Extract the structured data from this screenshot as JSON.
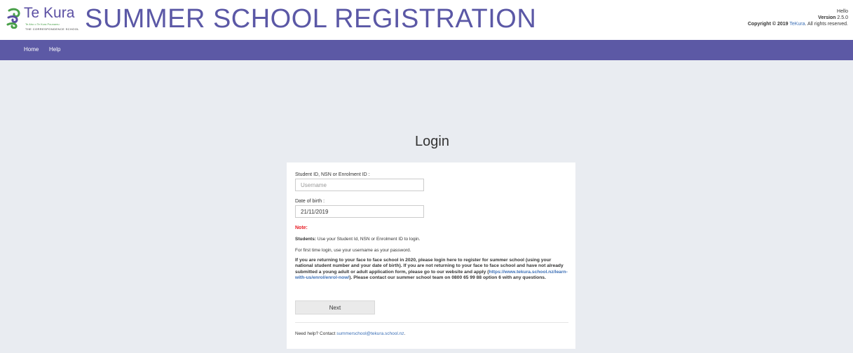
{
  "header": {
    "logo": {
      "name": "Te Kura",
      "tagline": "Te Aho o Te Kura Pounamu",
      "subtitle": "THE CORRESPONDENCE SCHOOL"
    },
    "app_title": "SUMMER SCHOOL REGISTRATION",
    "greeting": "Hello",
    "version_label": "Version",
    "version_value": "2.5.0",
    "copyright_prefix": "Copyright © 2019",
    "copyright_link": "TeKura",
    "copyright_suffix": ". All rights reserved."
  },
  "nav": {
    "items": [
      {
        "label": "Home"
      },
      {
        "label": "Help"
      }
    ]
  },
  "login": {
    "title": "Login",
    "username_label": "Student ID, NSN or Enrolment ID :",
    "username_placeholder": "Username",
    "username_value": "",
    "dob_label": "Date of birth :",
    "dob_value": "21/11/2019",
    "note_label": "Note:",
    "students_label": "Students:",
    "students_text": " Use your Student Id, NSN or Enrolment ID to login.",
    "first_login_text": "For first time login, use your username as your password.",
    "returning_text_1": "If you are returning to your face to face school in 2020, please login here to register for summer school (using your national student number and your date of birth). If you are not returning to your face to face school and have not already submitted a young adult or adult application form, please go to our website and apply (",
    "returning_link": "https://www.tekura.school.nz/learn-with-us/enrol/enrol-now/",
    "returning_text_2": "). Please contact our summer school team on 0800 65 99 88 option 6 with any questions.",
    "next_label": "Next",
    "help_prefix": "Need help? Contact ",
    "help_email": "summerschool@tekura.school.nz",
    "help_suffix": "."
  },
  "colors": {
    "brand_purple": "#5c59a5",
    "title_purple": "#5b58a6",
    "page_background": "#e9ecf1",
    "link_blue": "#3b6fb6",
    "note_red": "#e81b23",
    "logo_green": "#4aa04a"
  },
  "icons": {
    "logo_mark": "te-kura-koru-icon"
  }
}
